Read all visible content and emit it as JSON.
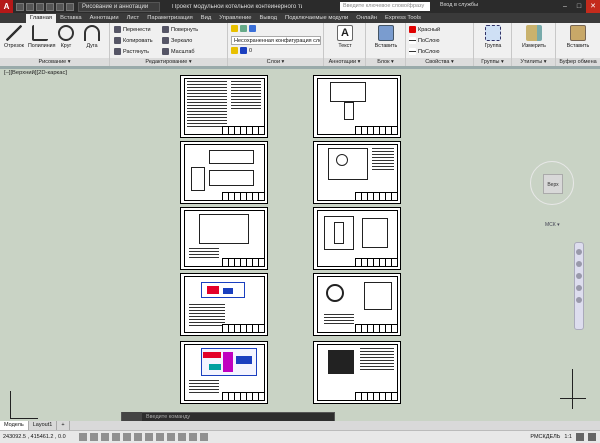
{
  "title_bar": {
    "app_letter": "A",
    "workspace": "Рисование и аннотации",
    "doc_title": "Проект модульной котельной контейнерного тип...",
    "search_placeholder": "Введите ключевое слово/фразу",
    "signin": "Вход в службы",
    "min": "–",
    "max": "□",
    "close": "✕"
  },
  "tabs": [
    "Главная",
    "Вставка",
    "Аннотации",
    "Лист",
    "Параметризация",
    "Вид",
    "Управление",
    "Вывод",
    "Подключаемые модули",
    "Онлайн",
    "Express Tools"
  ],
  "ribbon": {
    "draw": {
      "title": "Рисование ▾",
      "tools": [
        "Отрезок",
        "Полилиния",
        "Круг",
        "Дуга"
      ]
    },
    "modify": {
      "title": "Редактирование ▾",
      "tools": [
        "Перенести",
        "Копировать",
        "Растянуть",
        "Повернуть",
        "Зеркало",
        "Масштаб"
      ]
    },
    "layers": {
      "title": "Слои ▾",
      "layer_state": "Несохраненная конфигурация слоев",
      "current_layer": "0"
    },
    "annotation": {
      "title": "Аннотации ▾",
      "tool": "Текст"
    },
    "block": {
      "title": "Блок ▾",
      "tool": "Вставить"
    },
    "properties": {
      "title": "Свойства ▾",
      "color": "Красный",
      "linetype": "ПоСлою",
      "lineweight": "ПоСлою"
    },
    "groups": {
      "title": "Группы ▾",
      "tool": "Группа"
    },
    "utilities": {
      "title": "Утилиты ▾",
      "tool": "Измерить"
    },
    "clipboard": {
      "title": "Буфер обмена",
      "tool": "Вставить"
    }
  },
  "viewport": {
    "label": "[–][Верхний][2D-каркас]",
    "viewcube_face": "Верх",
    "ucs_label": "МСК ▾"
  },
  "command_line": {
    "placeholder": "Введите команду"
  },
  "layout_tabs": [
    "Модель",
    "Layout1",
    "+"
  ],
  "status": {
    "coords": "243092.5 , 415461.2 , 0.0",
    "model": "РМСКДЕЛЬ",
    "scale": "1:1"
  },
  "colors": {
    "accent": "#b51818",
    "viewport_bg": "#c9d3c5",
    "dark_bar": "#2b2b2b"
  }
}
